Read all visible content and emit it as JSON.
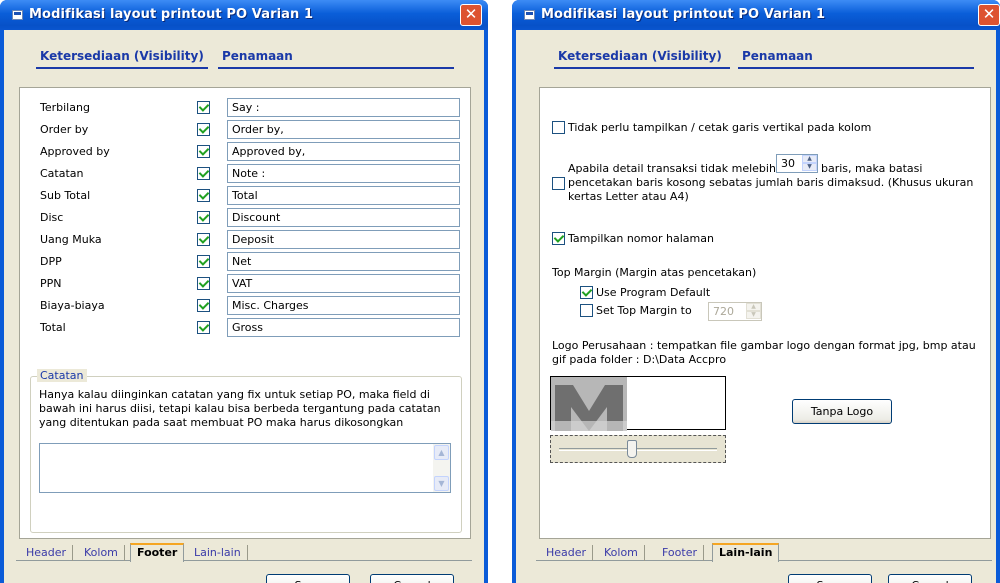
{
  "window_title": "Modifikasi layout printout PO Varian 1",
  "close_glyph": "✕",
  "header_tabs": [
    "Ketersediaan (Visibility)",
    "Penamaan"
  ],
  "footer_rows": [
    {
      "label": "Terbilang",
      "checked": true,
      "value": "Say :"
    },
    {
      "label": "Order by",
      "checked": true,
      "value": "Order by,"
    },
    {
      "label": "Approved by",
      "checked": true,
      "value": "Approved by,"
    },
    {
      "label": "Catatan",
      "checked": true,
      "value": "Note :"
    },
    {
      "label": "Sub Total",
      "checked": true,
      "value": "Total"
    },
    {
      "label": "Disc",
      "checked": true,
      "value": "Discount"
    },
    {
      "label": "Uang Muka",
      "checked": true,
      "value": "Deposit"
    },
    {
      "label": "DPP",
      "checked": true,
      "value": "Net"
    },
    {
      "label": "PPN",
      "checked": true,
      "value": "VAT"
    },
    {
      "label": "Biaya-biaya",
      "checked": true,
      "value": "Misc. Charges"
    },
    {
      "label": "Total",
      "checked": true,
      "value": "Gross"
    }
  ],
  "catatan": {
    "title": "Catatan",
    "text": "Hanya kalau diinginkan catatan yang fix untuk setiap PO, maka field di bawah ini harus diisi, tetapi kalau bisa berbeda tergantung pada catatan yang ditentukan pada saat membuat PO maka harus dikosongkan",
    "value": ""
  },
  "bottom_tabs": [
    "Header",
    "Kolom",
    "Footer",
    "Lain-lain"
  ],
  "active_tab_left": "Footer",
  "active_tab_right": "Lain-lain",
  "buttons": {
    "save": "Save",
    "save_key": "S",
    "save_rest": "ave",
    "cancel": "Cancel",
    "cancel_key": "C",
    "cancel_rest": "ancel"
  },
  "lain": {
    "no_vertical_lines": {
      "label": "Tidak perlu tampilkan / cetak garis vertikal pada kolom",
      "checked": false
    },
    "limit_rows": {
      "prefix": "Apabila detail transaksi tidak melebihi",
      "value": "30",
      "suffix": "baris, maka batasi",
      "line2": "pencetakan baris kosong sebatas jumlah baris dimaksud. (Khusus ukuran",
      "line3": "kertas Letter atau A4)",
      "checked": false
    },
    "show_page_number": {
      "label": "Tampilkan nomor halaman",
      "checked": true
    },
    "top_margin_title": "Top Margin (Margin atas pencetakan)",
    "use_default": {
      "label": "Use Program Default",
      "checked": true
    },
    "set_margin": {
      "label": "Set Top Margin to",
      "checked": false,
      "value": "720"
    },
    "logo_text_line1": "Logo Perusahaan : tempatkan file gambar logo dengan format jpg, bmp atau",
    "logo_text_line2": "gif pada folder : D:\\Data Accpro",
    "no_logo_button": "Tanpa Logo",
    "slider_value": 0.45
  }
}
